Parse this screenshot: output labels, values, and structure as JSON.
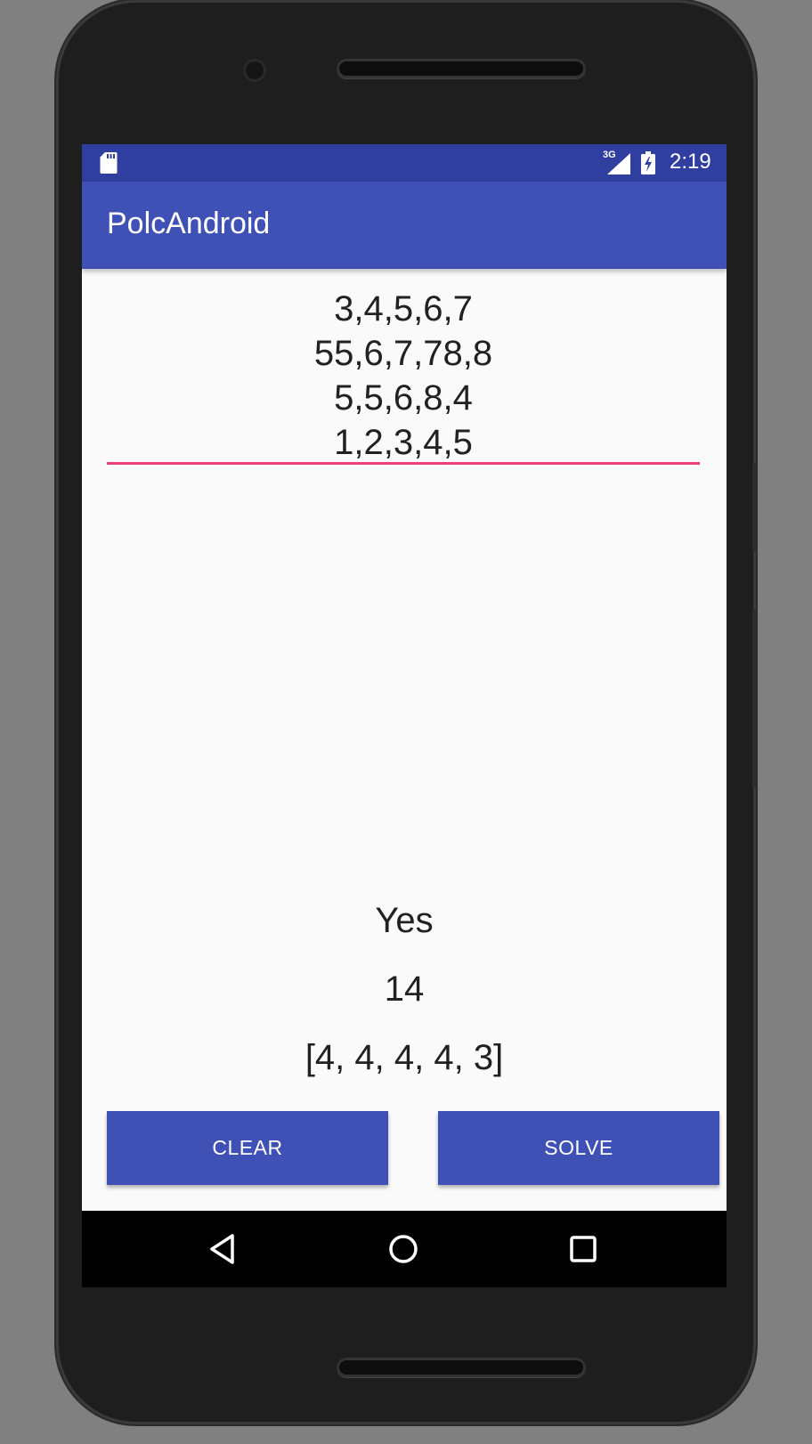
{
  "status_bar": {
    "network": "3G",
    "time": "2:19"
  },
  "app_bar": {
    "title": "PolcAndroid"
  },
  "input": {
    "lines": [
      "3,4,5,6,7",
      "55,6,7,78,8",
      "5,5,6,8,4",
      "1,2,3,4,5"
    ],
    "underline_color": "#ec407a"
  },
  "results": {
    "answer": "Yes",
    "count": "14",
    "sequence": "[4, 4, 4, 4, 3]"
  },
  "buttons": {
    "clear_label": "CLEAR",
    "solve_label": "SOLVE"
  },
  "colors": {
    "primary": "#3f51b5",
    "primary_dark": "#303f9f",
    "accent": "#ec407a",
    "background": "#fafafa"
  },
  "icons": {
    "status_left": "sd-card-icon",
    "signal": "cell-signal-icon",
    "battery": "battery-charging-icon",
    "nav": [
      "back-icon",
      "home-icon",
      "recent-apps-icon"
    ]
  }
}
